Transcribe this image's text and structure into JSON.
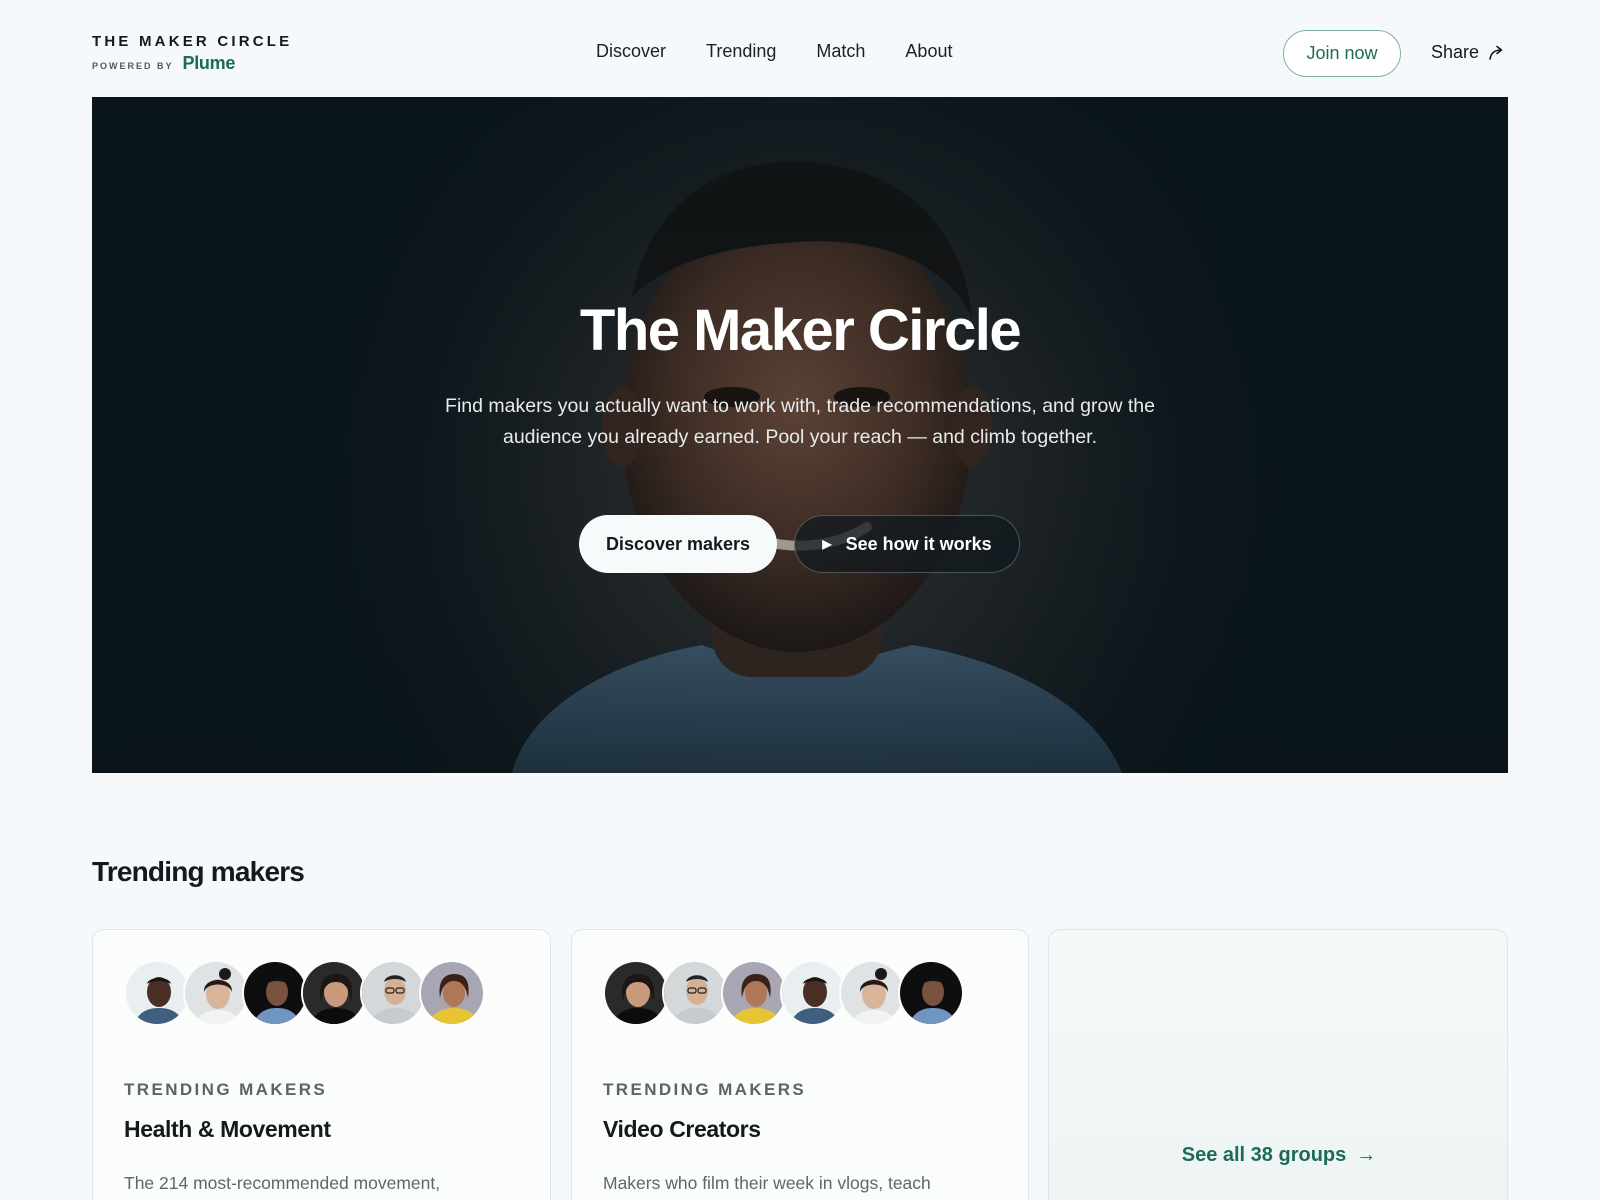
{
  "brand": {
    "title": "THE MAKER CIRCLE",
    "powered_by": "POWERED BY",
    "logo_name": "Plume"
  },
  "nav": {
    "items": [
      "Discover",
      "Trending",
      "Match",
      "About"
    ]
  },
  "header_actions": {
    "join_label": "Join now",
    "share_label": "Share",
    "share_icon": "share-arrow-icon"
  },
  "hero": {
    "title": "The Maker Circle",
    "text": "Find makers you actually want to work with, trade recommendations, and grow the audience you already earned. Pool your reach — and climb together.",
    "primary_button": "Discover makers",
    "secondary_button": "See how it works",
    "secondary_icon": "play-icon"
  },
  "trending": {
    "title": "Trending makers",
    "cards": [
      {
        "eyebrow": "TRENDING MAKERS",
        "title": "Health & Movement",
        "description": "The 214 most-recommended movement,"
      },
      {
        "eyebrow": "TRENDING MAKERS",
        "title": "Video Creators",
        "description": "Makers who film their week in vlogs, teach"
      }
    ],
    "see_all": "See all 38 groups",
    "see_all_icon": "arrow-right-icon"
  },
  "colors": {
    "accent": "#1d6b57",
    "background": "#f5f9fb",
    "hero_dark": "#0b161c"
  }
}
